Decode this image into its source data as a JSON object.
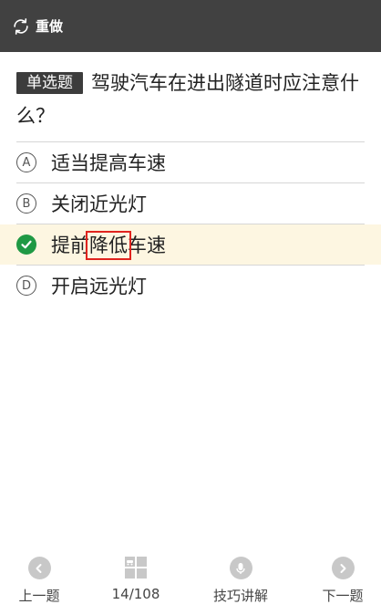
{
  "header": {
    "redo_label": "重做",
    "icon": "refresh-icon"
  },
  "question": {
    "type_badge": "单选题",
    "text": "驾驶汽车在进出隧道时应注意什么？"
  },
  "options": [
    {
      "marker": "Ⓐ",
      "text": "适当提高车速",
      "state": "normal"
    },
    {
      "marker": "Ⓑ",
      "text": "关闭近光灯",
      "state": "normal"
    },
    {
      "marker": "check",
      "text_before": "提前",
      "text_highlight": "降低",
      "text_after": "车速",
      "state": "correct"
    },
    {
      "marker": "Ⓓ",
      "text": "开启远光灯",
      "state": "normal"
    }
  ],
  "bottom_nav": {
    "prev": {
      "label": "上一题",
      "icon": "chevron-left-icon"
    },
    "progress": {
      "label": "14/108",
      "icon": "grid-icon"
    },
    "tips": {
      "label": "技巧讲解",
      "icon": "microphone-icon"
    },
    "next": {
      "label": "下一题",
      "icon": "chevron-right-icon"
    }
  },
  "colors": {
    "header_bg": "#414141",
    "correct_bg": "#fdf6e1",
    "correct_check": "#1f9944",
    "highlight_box": "#e0231e",
    "nav_icon": "#c8c8c8"
  }
}
